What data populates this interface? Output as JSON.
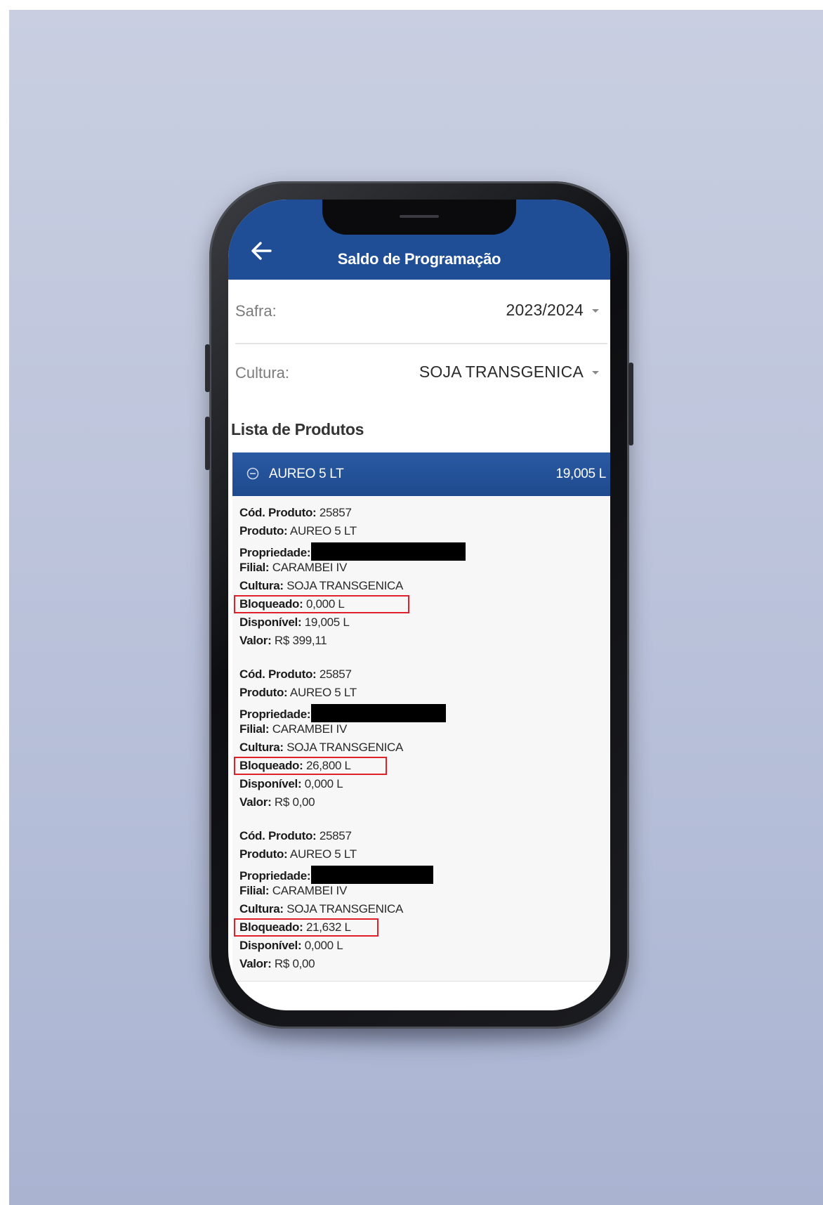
{
  "app": {
    "title": "Saldo de Programação"
  },
  "filters": {
    "safra_label": "Safra:",
    "safra_value": "2023/2024",
    "cultura_label": "Cultura:",
    "cultura_value": "SOJA TRANSGENICA"
  },
  "list": {
    "title": "Lista de Produtos",
    "group_name": "AUREO 5 LT",
    "group_total": "19,005 L",
    "field_labels": {
      "cod": "Cód. Produto:",
      "produto": "Produto:",
      "propriedade": "Propriedade:",
      "filial": "Filial:",
      "cultura": "Cultura:",
      "bloqueado": "Bloqueado:",
      "disponivel": "Disponível:",
      "valor": "Valor:"
    },
    "items": [
      {
        "cod": "25857",
        "produto": "AUREO 5 LT",
        "filial": "CARAMBEI IV",
        "cultura": "SOJA TRANSGENICA",
        "bloqueado": "0,000 L",
        "disponivel": "19,005 L",
        "valor": "R$ 399,11"
      },
      {
        "cod": "25857",
        "produto": "AUREO 5 LT",
        "filial": "CARAMBEI IV",
        "cultura": "SOJA TRANSGENICA",
        "bloqueado": "26,800 L",
        "disponivel": "0,000 L",
        "valor": "R$ 0,00"
      },
      {
        "cod": "25857",
        "produto": "AUREO 5 LT",
        "filial": "CARAMBEI IV",
        "cultura": "SOJA TRANSGENICA",
        "bloqueado": "21,632 L",
        "disponivel": "0,000 L",
        "valor": "R$ 0,00"
      }
    ]
  },
  "colors": {
    "header_blue": "#1f4e97",
    "highlight_red": "#e0202a"
  },
  "icons": {
    "back": "arrow-left",
    "dropdown": "caret-down",
    "collapse": "circle-minus"
  }
}
